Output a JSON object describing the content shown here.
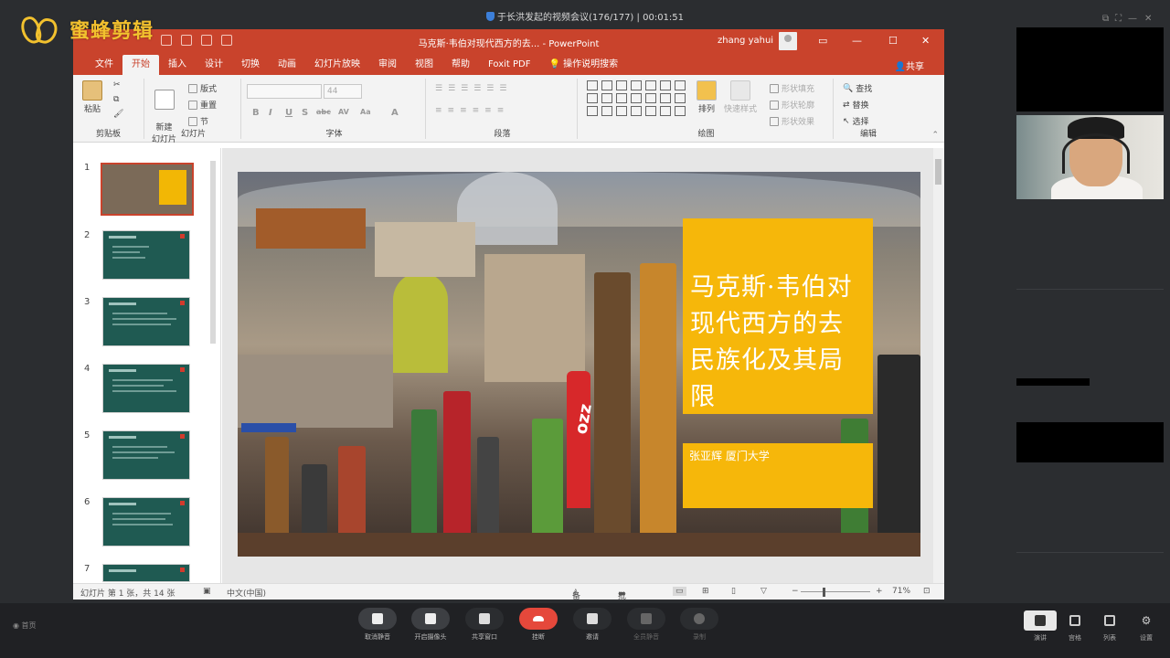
{
  "meeting": {
    "title": "于长洪发起的视频会议(176/177)",
    "separator": "|",
    "elapsed": "00:01:51"
  },
  "watermark": {
    "text": "蜜蜂剪辑"
  },
  "ppt": {
    "window_title": "马克斯·韦伯对现代西方的去... - PowerPoint",
    "user": "zhang yahui",
    "tabs": [
      "文件",
      "开始",
      "插入",
      "设计",
      "切换",
      "动画",
      "幻灯片放映",
      "审阅",
      "视图",
      "帮助",
      "Foxit PDF",
      "操作说明搜索"
    ],
    "active_tab": "开始",
    "share": "共享",
    "ribbon": {
      "clipboard": {
        "paste": "粘贴",
        "label": "剪贴板"
      },
      "slides": {
        "new_slide": "新建\n幻灯片",
        "layout": "版式",
        "reset": "重置",
        "section": "节",
        "label": "幻灯片"
      },
      "font": {
        "size": "44",
        "label": "字体",
        "bold": "B",
        "italic": "I",
        "underline": "U",
        "shadow": "S",
        "strike": "abc",
        "spacing": "AV",
        "case": "Aa",
        "color": "A"
      },
      "paragraph": {
        "label": "段落"
      },
      "drawing": {
        "arrange": "排列",
        "quick_styles": "快速样式",
        "fill": "形状填充",
        "outline": "形状轮廓",
        "effects": "形状效果",
        "label": "绘图"
      },
      "editing": {
        "find": "查找",
        "replace": "替换",
        "select": "选择",
        "label": "编辑"
      }
    },
    "thumbnails": [
      "1",
      "2",
      "3",
      "4",
      "5",
      "6",
      "7"
    ],
    "slide": {
      "title": "马克斯·韦伯对现代西方的去民族化及其局限",
      "subtitle": "张亚辉 厦门大学",
      "banner": "ozz"
    },
    "status": {
      "slide_info": "幻灯片 第 1 张，共 14 张",
      "language": "中文(中国)",
      "notes": "备注",
      "comments": "批注",
      "zoom": "71%"
    }
  },
  "toolbar": {
    "left": "首页",
    "buttons": [
      {
        "label": "取消静音"
      },
      {
        "label": "开启摄像头"
      },
      {
        "label": "共享窗口"
      },
      {
        "label": "挂断"
      },
      {
        "label": "邀请"
      },
      {
        "label": "全员静音"
      },
      {
        "label": "录制"
      }
    ],
    "right": [
      {
        "label": "演讲"
      },
      {
        "label": "宫格"
      },
      {
        "label": "列表"
      },
      {
        "label": "设置"
      }
    ]
  }
}
